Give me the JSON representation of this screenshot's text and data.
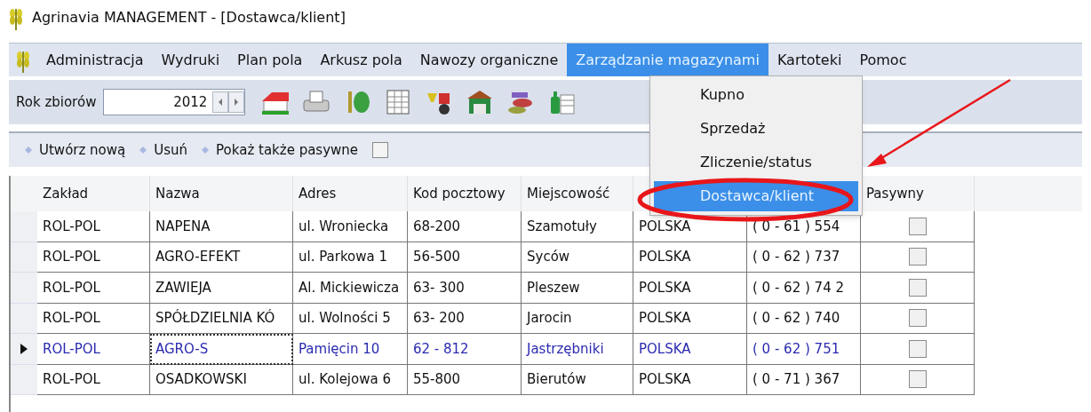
{
  "window": {
    "title": "Agrinavia MANAGEMENT - [Dostawca/klient]"
  },
  "menu": [
    {
      "label": "Administracja",
      "selected": false
    },
    {
      "label": "Wydruki",
      "selected": false
    },
    {
      "label": "Plan pola",
      "selected": false
    },
    {
      "label": "Arkusz pola",
      "selected": false
    },
    {
      "label": "Nawozy organiczne",
      "selected": false
    },
    {
      "label": "Zarządzanie magazynami",
      "selected": true
    },
    {
      "label": "Kartoteki",
      "selected": false
    },
    {
      "label": "Pomoc",
      "selected": false
    }
  ],
  "dropdown": [
    {
      "label": "Kupno",
      "selected": false
    },
    {
      "label": "Sprzedaż",
      "selected": false
    },
    {
      "label": "Zliczenie/status",
      "selected": false
    },
    {
      "label": "Dostawca/klient",
      "selected": true
    }
  ],
  "toolbar": {
    "year_label": "Rok zbiorów",
    "year": "2012"
  },
  "actions": {
    "create": "Utwórz nową",
    "delete": "Usuń",
    "show_passive": "Pokaż także pasywne",
    "show_passive_checked": false
  },
  "table": {
    "columns": [
      "Zakład",
      "Nazwa",
      "Adres",
      "Kod pocztowy",
      "Miejscowość",
      null,
      null,
      "Pasywny"
    ],
    "rows": [
      {
        "cells": [
          "ROL-POL",
          "NAPENA",
          "ul. Wroniecka",
          "68-200",
          "Szamotuły",
          "POLSKA",
          "( 0 - 61 ) 554"
        ],
        "passive": false,
        "selected": false
      },
      {
        "cells": [
          "ROL-POL",
          "AGRO-EFEKT",
          "ul. Parkowa 1",
          "56-500",
          "Syców",
          "POLSKA",
          "( 0 - 62 ) 737"
        ],
        "passive": false,
        "selected": false
      },
      {
        "cells": [
          "ROL-POL",
          "ZAWIEJA",
          "Al. Mickiewicza",
          "63- 300",
          "Pleszew",
          "POLSKA",
          "( 0 - 62 ) 74 2"
        ],
        "passive": false,
        "selected": false
      },
      {
        "cells": [
          "ROL-POL",
          "SPÓŁDZIELNIA KÓ",
          "ul. Wolności 5",
          "63- 200",
          "Jarocin",
          "POLSKA",
          "( 0 - 62 ) 740"
        ],
        "passive": false,
        "selected": false
      },
      {
        "cells": [
          "ROL-POL",
          "AGRO-S",
          "Pamięcin 10",
          "62 - 812",
          "Jastrzębniki",
          "POLSKA",
          "( 0 - 62 ) 751"
        ],
        "passive": false,
        "selected": true
      },
      {
        "cells": [
          "ROL-POL",
          "OSADKOWSKI",
          "ul. Kolejowa 6",
          "55-800",
          "Bierutów",
          "POLSKA",
          "( 0 - 71 ) 367"
        ],
        "passive": false,
        "selected": false
      }
    ]
  }
}
